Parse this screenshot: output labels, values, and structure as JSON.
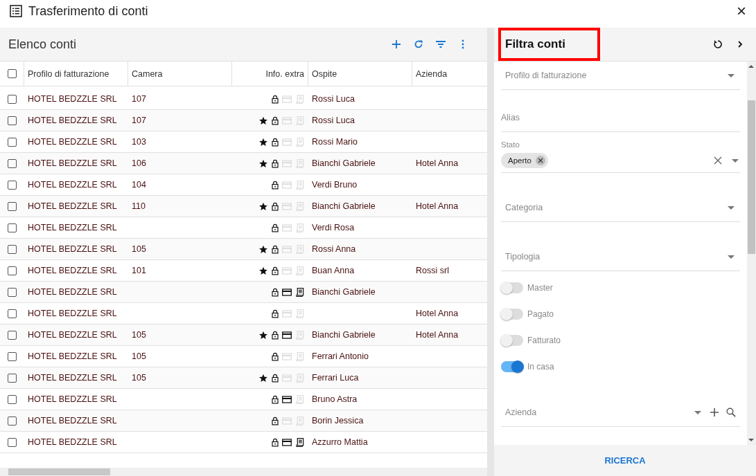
{
  "window": {
    "title": "Trasferimento di conti",
    "close": "×"
  },
  "list": {
    "title": "Elenco conti",
    "all_checked": false,
    "columns": [
      "Profilo di fatturazione",
      "Camera",
      "Info. extra",
      "Ospite",
      "Azienda"
    ],
    "rows": [
      {
        "profile": "HOTEL BEDZZLE SRL",
        "room": "107",
        "star": false,
        "card": false,
        "invoice": false,
        "guest": "Rossi Luca",
        "company": "",
        "checked": false
      },
      {
        "profile": "HOTEL BEDZZLE SRL",
        "room": "107",
        "star": true,
        "card": false,
        "invoice": false,
        "guest": "Rossi Luca",
        "company": "",
        "checked": false
      },
      {
        "profile": "HOTEL BEDZZLE SRL",
        "room": "103",
        "star": true,
        "card": false,
        "invoice": false,
        "guest": "Rossi Mario",
        "company": "",
        "checked": false
      },
      {
        "profile": "HOTEL BEDZZLE SRL",
        "room": "106",
        "star": true,
        "card": false,
        "invoice": false,
        "guest": "Bianchi Gabriele",
        "company": "Hotel Anna",
        "checked": false
      },
      {
        "profile": "HOTEL BEDZZLE SRL",
        "room": "104",
        "star": false,
        "card": false,
        "invoice": false,
        "guest": "Verdi Bruno",
        "company": "",
        "checked": false
      },
      {
        "profile": "HOTEL BEDZZLE SRL",
        "room": "110",
        "star": true,
        "card": false,
        "invoice": false,
        "guest": "Bianchi Gabriele",
        "company": "Hotel Anna",
        "checked": false
      },
      {
        "profile": "HOTEL BEDZZLE SRL",
        "room": "",
        "star": false,
        "card": false,
        "invoice": false,
        "guest": "Verdi Rosa",
        "company": "",
        "checked": false
      },
      {
        "profile": "HOTEL BEDZZLE SRL",
        "room": "105",
        "star": true,
        "card": false,
        "invoice": false,
        "guest": "Rossi Anna",
        "company": "",
        "checked": false
      },
      {
        "profile": "HOTEL BEDZZLE SRL",
        "room": "101",
        "star": true,
        "card": false,
        "invoice": false,
        "guest": "Buan Anna",
        "company": "Rossi srl",
        "checked": false
      },
      {
        "profile": "HOTEL BEDZZLE SRL",
        "room": "",
        "star": false,
        "card": true,
        "invoice": true,
        "guest": "Bianchi Gabriele",
        "company": "",
        "checked": false
      },
      {
        "profile": "HOTEL BEDZZLE SRL",
        "room": "",
        "star": false,
        "card": false,
        "invoice": false,
        "guest": "",
        "company": "Hotel Anna",
        "checked": false
      },
      {
        "profile": "HOTEL BEDZZLE SRL",
        "room": "105",
        "star": true,
        "card": true,
        "invoice": false,
        "guest": "Bianchi Gabriele",
        "company": "Hotel Anna",
        "checked": false
      },
      {
        "profile": "HOTEL BEDZZLE SRL",
        "room": "105",
        "star": false,
        "card": false,
        "invoice": false,
        "guest": "Ferrari Antonio",
        "company": "",
        "checked": false
      },
      {
        "profile": "HOTEL BEDZZLE SRL",
        "room": "105",
        "star": true,
        "card": false,
        "invoice": false,
        "guest": "Ferrari Luca",
        "company": "",
        "checked": false
      },
      {
        "profile": "HOTEL BEDZZLE SRL",
        "room": "",
        "star": false,
        "card": true,
        "invoice": false,
        "guest": "Bruno Astra",
        "company": "",
        "checked": false
      },
      {
        "profile": "HOTEL BEDZZLE SRL",
        "room": "",
        "star": false,
        "card": false,
        "invoice": false,
        "guest": "Borin Jessica",
        "company": "",
        "checked": false
      },
      {
        "profile": "HOTEL BEDZZLE SRL",
        "room": "",
        "star": false,
        "card": true,
        "invoice": true,
        "guest": "Azzurro Mattia",
        "company": "",
        "checked": false
      }
    ]
  },
  "filter": {
    "title": "Filtra conti",
    "billing_profile": {
      "placeholder": "Profilo di fatturazione"
    },
    "alias": {
      "placeholder": "Alias"
    },
    "status": {
      "label": "Stato",
      "chips": [
        "Aperto"
      ]
    },
    "category": {
      "placeholder": "Categoria"
    },
    "type": {
      "placeholder": "Tipologia"
    },
    "toggles": [
      {
        "label": "Master",
        "on": false
      },
      {
        "label": "Pagato",
        "on": false
      },
      {
        "label": "Fatturato",
        "on": false
      },
      {
        "label": "In casa",
        "on": true
      }
    ],
    "company": {
      "placeholder": "Azienda"
    },
    "search_button": "RICERCA"
  }
}
